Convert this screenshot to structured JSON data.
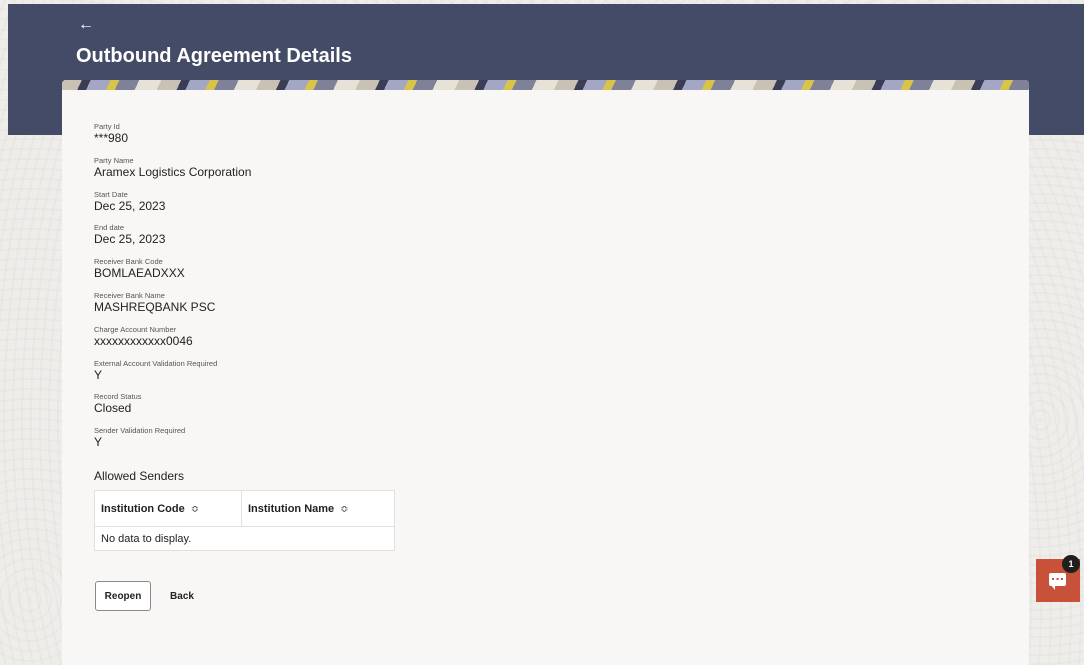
{
  "header": {
    "back_icon": "←",
    "title": "Outbound Agreement Details"
  },
  "details": [
    {
      "label": "Party Id",
      "value": "***980"
    },
    {
      "label": "Party Name",
      "value": "Aramex Logistics Corporation"
    },
    {
      "label": "Start Date",
      "value": "Dec 25, 2023"
    },
    {
      "label": "End date",
      "value": "Dec 25, 2023"
    },
    {
      "label": "Receiver Bank Code",
      "value": "BOMLAEADXXX"
    },
    {
      "label": "Receiver Bank Name",
      "value": "MASHREQBANK PSC"
    },
    {
      "label": "Charge Account Number",
      "value": "xxxxxxxxxxxx0046"
    },
    {
      "label": "External Account Validation Required",
      "value": "Y"
    },
    {
      "label": "Record Status",
      "value": "Closed"
    },
    {
      "label": "Sender Validation Required",
      "value": "Y"
    }
  ],
  "allowed_senders": {
    "title": "Allowed Senders",
    "columns": [
      "Institution Code",
      "Institution Name"
    ],
    "sort_icon": "≎",
    "empty_message": "No data to display."
  },
  "actions": {
    "reopen_label": "Reopen",
    "back_label": "Back"
  },
  "chat": {
    "badge_count": "1",
    "icon": "chat-icon"
  },
  "colors": {
    "header_band": "#434b67",
    "chat_accent": "#c8513a"
  }
}
